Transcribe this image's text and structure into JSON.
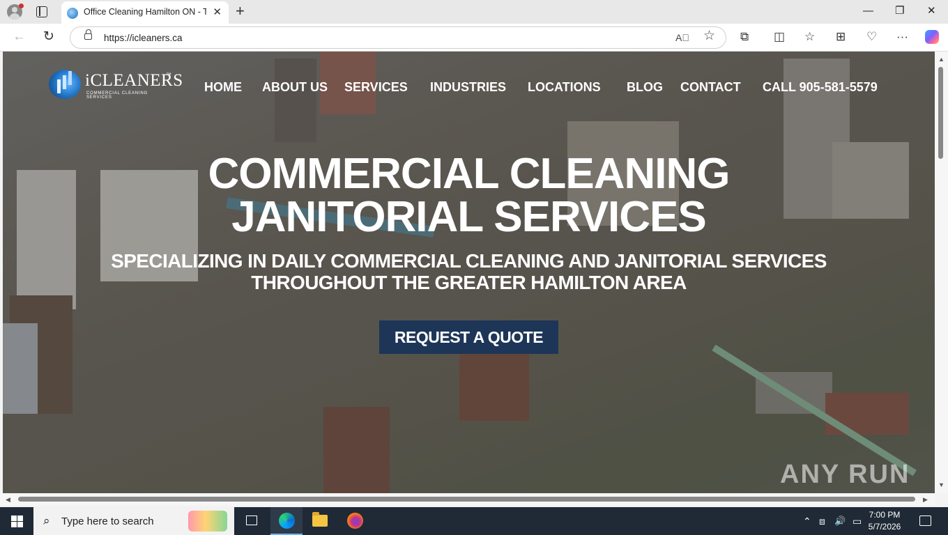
{
  "browser": {
    "tab_title": "Office Cleaning Hamilton ON - Tri",
    "tab_close": "✕",
    "new_tab": "+",
    "window_controls": {
      "minimize": "—",
      "restore": "❐",
      "close": "✕"
    },
    "nav": {
      "back": "←",
      "refresh": "↻"
    },
    "url": "https://icleaners.ca",
    "address_icons": {
      "read_aloud": "A᪲",
      "favorite": "☆"
    },
    "toolbar_icons": [
      "extensions-icon",
      "split-screen-icon",
      "favorites-icon",
      "collections-icon",
      "browser-essentials-icon",
      "more-icon",
      "copilot-icon"
    ],
    "toolbar_glyphs": {
      "extensions": "⧉",
      "split": "◫",
      "favorites": "☆",
      "collections": "⊞",
      "essentials": "♡",
      "more": "···"
    }
  },
  "site": {
    "logo": {
      "name": "iCLEANERS",
      "trademark": "™",
      "tagline": "COMMERCIAL CLEANING SERVICES"
    },
    "menu": [
      "HOME",
      "ABOUT US",
      "SERVICES",
      "INDUSTRIES",
      "LOCATIONS",
      "BLOG",
      "CONTACT",
      "CALL 905-581-5579"
    ],
    "hero": {
      "title_line1": "COMMERCIAL CLEANING",
      "title_line2": "JANITORIAL SERVICES",
      "subtitle_line1": "SPECIALIZING IN DAILY COMMERCIAL CLEANING AND JANITORIAL SERVICES",
      "subtitle_line2": "THROUGHOUT THE GREATER HAMILTON AREA",
      "cta": "REQUEST A QUOTE"
    },
    "watermark": "ANY RUN"
  },
  "taskbar": {
    "search_placeholder": "Type here to search",
    "search_glyph": "⌕",
    "apps": [
      "task-view-icon",
      "edge-icon",
      "file-explorer-icon",
      "firefox-icon"
    ],
    "tray": {
      "chevron": "⌃",
      "meet": "⧈",
      "volume": "🔊",
      "network": "▭"
    },
    "time": "7:00 PM",
    "date": "5/7/2026"
  },
  "colors": {
    "cta_bg": "#1d3557",
    "taskbar_bg": "#1f2a36",
    "overlay": "rgba(60,60,60,0.38)"
  }
}
